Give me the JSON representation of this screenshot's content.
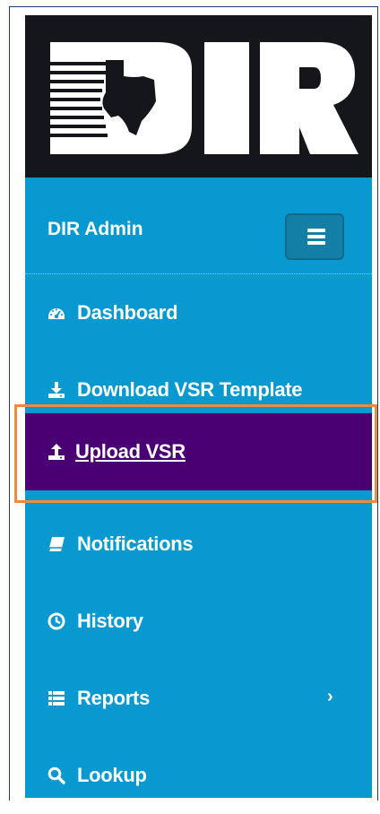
{
  "logo": {
    "text": "DIR",
    "colors": {
      "background": "#15161b",
      "letters": "#ffffff"
    }
  },
  "header": {
    "user_name": "DIR Admin",
    "menu_icon": "hamburger-icon"
  },
  "nav": {
    "items": [
      {
        "label": "Dashboard",
        "icon": "dashboard-icon"
      },
      {
        "label": "Download VSR Template",
        "icon": "download-icon"
      },
      {
        "label": " Upload VSR",
        "icon": "upload-icon",
        "active": true
      },
      {
        "label": "Notifications",
        "icon": "book-icon"
      },
      {
        "label": "History",
        "icon": "clock-icon"
      },
      {
        "label": "Reports",
        "icon": "list-icon",
        "has_submenu": true,
        "chevron": "›"
      },
      {
        "label": "Lookup",
        "icon": "search-icon"
      }
    ]
  },
  "colors": {
    "sidebar": "#0799cf",
    "active_item": "#4a0072",
    "highlight_border": "#ee8a3a",
    "text": "#ffffff"
  }
}
